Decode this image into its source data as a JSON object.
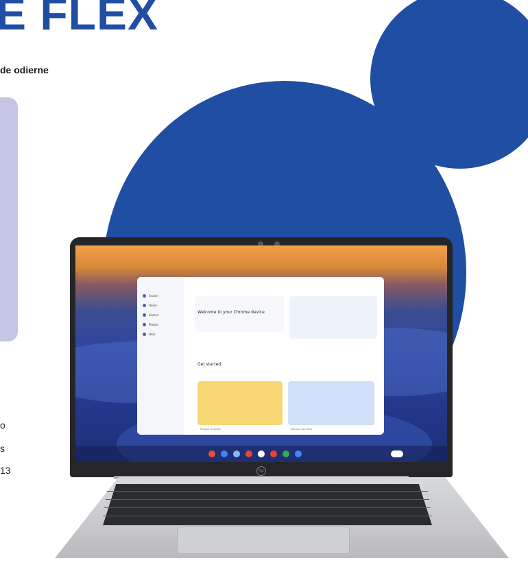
{
  "headline": "E FLEX",
  "subline": "de odierne",
  "side_fragments": [
    "o",
    "s",
    "13"
  ],
  "colors": {
    "brand_blue": "#1f4ea3",
    "lavender": "#c4c6e4"
  },
  "laptop_window": {
    "nav": [
      "Search",
      "Home",
      "Games",
      "Photos",
      "Help"
    ],
    "welcome_title": "Welcome to your Chrome device",
    "get_started": "Get started",
    "cards": [
      "Prepare to switch",
      "Manage your files"
    ],
    "logo_label": "hp"
  }
}
